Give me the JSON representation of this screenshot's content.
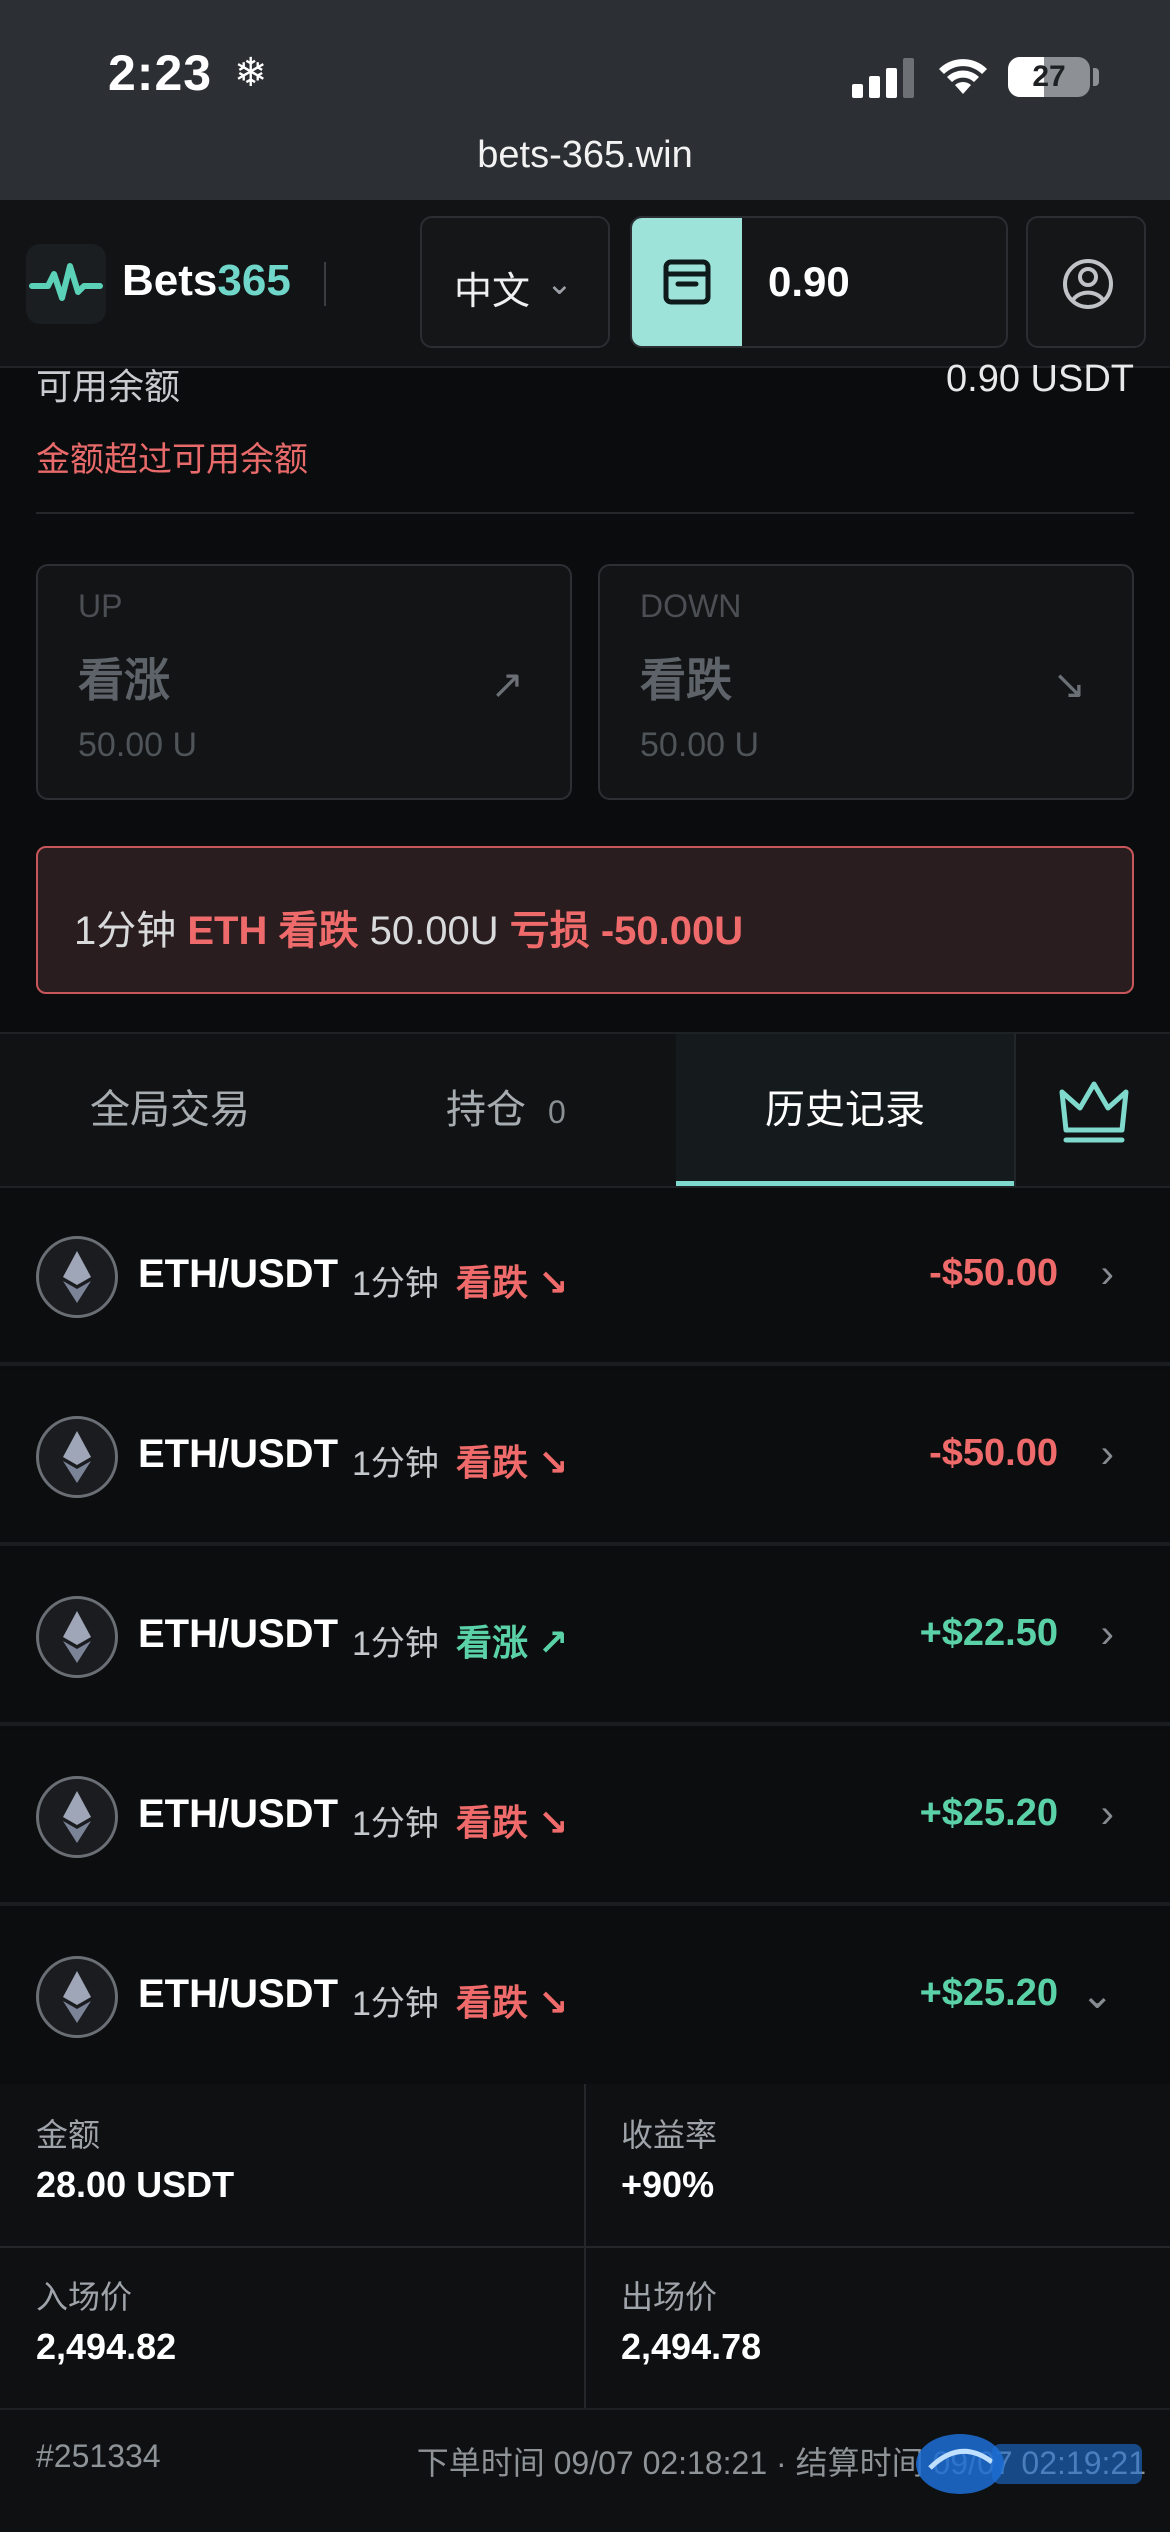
{
  "status_bar": {
    "time": "2:23",
    "battery": "27",
    "url": "bets-365.win"
  },
  "header": {
    "brand_prefix": "Bets",
    "brand_suffix": "365",
    "language": "中文",
    "wallet_balance": "0.90",
    "accent_color": "#9ee3d9"
  },
  "balance": {
    "label": "可用余额",
    "value": "0.90 USDT",
    "error": "金额超过可用余额"
  },
  "direction_buttons": [
    {
      "tag": "UP",
      "title": "看涨",
      "amount": "50.00 U"
    },
    {
      "tag": "DOWN",
      "title": "看跌",
      "amount": "50.00 U"
    }
  ],
  "notice": {
    "period": "1分钟",
    "pair_dir": "ETH 看跌",
    "amount": "50.00U",
    "result": "亏损 -50.00U"
  },
  "tabs": [
    {
      "label": "全局交易"
    },
    {
      "label": "持仓",
      "count": "0"
    },
    {
      "label": "历史记录"
    }
  ],
  "history": [
    {
      "pair": "ETH/USDT",
      "period": "1分钟",
      "direction": "看跌",
      "pnl": "-$50.00"
    },
    {
      "pair": "ETH/USDT",
      "period": "1分钟",
      "direction": "看跌",
      "pnl": "-$50.00"
    },
    {
      "pair": "ETH/USDT",
      "period": "1分钟",
      "direction": "看涨",
      "pnl": "+$22.50"
    },
    {
      "pair": "ETH/USDT",
      "period": "1分钟",
      "direction": "看跌",
      "pnl": "+$25.20"
    },
    {
      "pair": "ETH/USDT",
      "period": "1分钟",
      "direction": "看跌",
      "pnl": "+$25.20"
    }
  ],
  "detail": {
    "amount_label": "金额",
    "amount_value": "28.00 USDT",
    "rate_label": "收益率",
    "rate_value": "+90%",
    "entry_label": "入场价",
    "entry_value": "2,494.82",
    "exit_label": "出场价",
    "exit_value": "2,494.78",
    "order_id": "#251334",
    "times": "下单时间 09/07 02:18:21 · 结算时间 09/07 02:19:21"
  },
  "colors": {
    "up": "#5bd1a8",
    "down": "#ef6a6a"
  }
}
